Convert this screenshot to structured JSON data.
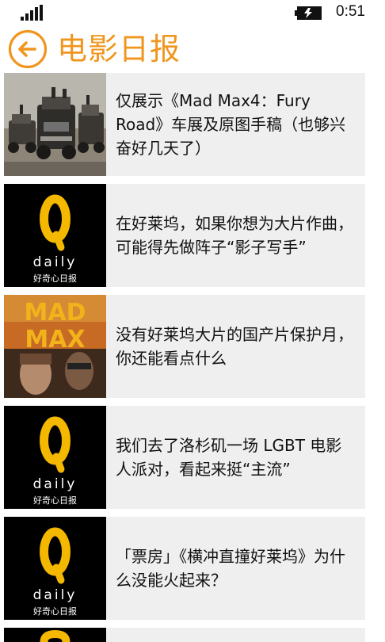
{
  "status_bar": {
    "time": "0:51",
    "signal_icon": "signal-bars-icon",
    "battery_icon": "battery-charging-icon"
  },
  "header": {
    "title": "电影日报",
    "back_icon": "back-arrow-icon"
  },
  "colors": {
    "accent": "#F0961E",
    "tile_background": "#EFEFEF",
    "logo_background": "#000000",
    "logo_yellow": "#F5B800"
  },
  "logo": {
    "letter": "Q",
    "word": "daily",
    "tagline": "好奇心日报"
  },
  "articles": [
    {
      "title": "仅展示《Mad Max4：Fury Road》车展及原图手稿（也够兴奋好几天了）",
      "thumbnail": "car-convoy-photo"
    },
    {
      "title": "在好莱坞，如果你想为大片作曲，可能得先做阵子“影子写手”",
      "thumbnail": "qdaily-logo"
    },
    {
      "title": "没有好莱坞大片的国产片保护月，你还能看点什么",
      "thumbnail": "mad-max-poster",
      "poster_text_1": "MAD",
      "poster_text_2": "MAX"
    },
    {
      "title": "我们去了洛杉矶一场 LGBT 电影人派对，看起来挺“主流”",
      "thumbnail": "qdaily-logo"
    },
    {
      "title": "「票房」《横冲直撞好莱坞》为什么没能火起来？",
      "thumbnail": "qdaily-logo"
    },
    {
      "title": "",
      "thumbnail": "qdaily-logo"
    }
  ]
}
